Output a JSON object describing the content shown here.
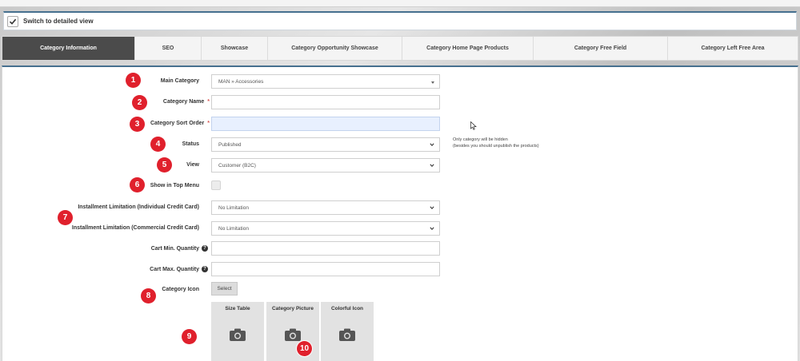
{
  "switch_view": {
    "label": "Switch to detailed view",
    "checked": true
  },
  "tabs": [
    {
      "label": "Category Information",
      "active": true
    },
    {
      "label": "SEO",
      "active": false
    },
    {
      "label": "Showcase",
      "active": false
    },
    {
      "label": "Category Opportunity Showcase",
      "active": false
    },
    {
      "label": "Category Home Page Products",
      "active": false
    },
    {
      "label": "Category Free Field",
      "active": false
    },
    {
      "label": "Category Left Free Area",
      "active": false
    }
  ],
  "form": {
    "main_category": {
      "label": "Main Category",
      "value": "MAN » Accessories"
    },
    "category_name": {
      "label": "Category Name",
      "required_mark": "*",
      "value": ""
    },
    "category_sort_order": {
      "label": "Category Sort Order",
      "required_mark": "*",
      "value": ""
    },
    "status": {
      "label": "Status",
      "value": "Published"
    },
    "status_note_line1": "Only category will be hidden",
    "status_note_line2": "(besides you should unpublish the products)",
    "view": {
      "label": "View",
      "value": "Customer (B2C)"
    },
    "show_in_top_menu": {
      "label": "Show in Top Menu",
      "checked": false
    },
    "installment_individual": {
      "label": "Installment Limitation (Individual Credit Card)",
      "value": "No Limitation"
    },
    "installment_commercial": {
      "label": "Installment Limitation (Commercial Credit Card)",
      "value": "No Limitation"
    },
    "cart_min": {
      "label": "Cart Min. Quantity",
      "value": ""
    },
    "cart_max": {
      "label": "Cart Max. Quantity",
      "value": ""
    },
    "category_icon": {
      "label": "Category Icon",
      "button": "Select"
    },
    "images": [
      {
        "label": "Size Table"
      },
      {
        "label": "Category Picture"
      },
      {
        "label": "Colorful Icon"
      }
    ]
  },
  "badges": [
    "1",
    "2",
    "3",
    "4",
    "5",
    "6",
    "7",
    "8",
    "9",
    "10"
  ],
  "colors": {
    "badge": "#e0202c",
    "active_tab": "#4b4b4b",
    "accent_border": "#46708f"
  }
}
